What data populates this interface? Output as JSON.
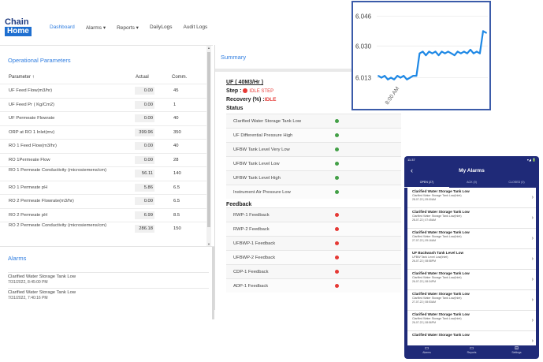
{
  "brand": {
    "line1": "Chain",
    "line2": "Home"
  },
  "nav": {
    "items": [
      "Dashboard",
      "Alarms ▾",
      "Reports ▾",
      "DailyLogs",
      "Audit Logs"
    ]
  },
  "operational": {
    "title": "Operational Parameters",
    "headers": {
      "param": "Parameter ↑",
      "actual": "Actual",
      "comm": "Comm."
    },
    "rows": [
      {
        "name": "UF Feed Flow(m3/hr)",
        "actual": "0.00",
        "comm": "45"
      },
      {
        "name": "UF Feed Pr ( Kg/Cm2)",
        "actual": "0.00",
        "comm": "1"
      },
      {
        "name": "UF Permeate Flowrate",
        "actual": "0.00",
        "comm": "40"
      },
      {
        "name": "ORP at RO 1 Inlet(mv)",
        "actual": "399.96",
        "comm": "350"
      },
      {
        "name": "RO 1 Feed Flow(m3/hr)",
        "actual": "0.00",
        "comm": "40"
      },
      {
        "name": "RO 1Permeate Flow",
        "actual": "0.00",
        "comm": "28"
      },
      {
        "name": "RO 1 Permeate Conductivity (microsiemens/cm)",
        "actual": "56.11",
        "comm": "140"
      },
      {
        "name": "RO 1 Permeate pH",
        "actual": "5.86",
        "comm": "6.5"
      },
      {
        "name": "RO 2 Permeate Flowrate(m3/hr)",
        "actual": "0.00",
        "comm": "6.5"
      },
      {
        "name": "RO 2 Permeate pH",
        "actual": "6.99",
        "comm": "8.5"
      },
      {
        "name": "RO 2 Permeate Conductivity (microsiemens/cm)",
        "actual": "286.18",
        "comm": "150"
      }
    ]
  },
  "alarms": {
    "title": "Alarms",
    "items": [
      {
        "text": "Clarified Water Storage Tank Low",
        "time": "7/31/2022, 8:45:00 PM"
      },
      {
        "text": "Clarified Water Storage Tank Low",
        "time": "7/31/2022, 7:40:16 PM"
      }
    ]
  },
  "summary": {
    "title": "Summary",
    "unit": "UF ( 40M3/Hr )",
    "step_label": "Step :",
    "step_value": "IDLE STEP",
    "recovery_label": "Recovery (%) :",
    "recovery_value": "IDLE",
    "status_title": "Status",
    "status": [
      {
        "label": "Clarified Water Storage Tank Low",
        "state": "green"
      },
      {
        "label": "UF Differential Pressure High",
        "state": "green"
      },
      {
        "label": "UFBW Tank Level Very Low",
        "state": "green"
      },
      {
        "label": "UFBW Tank Level Low",
        "state": "green"
      },
      {
        "label": "UFBW Tank Level High",
        "state": "green"
      },
      {
        "label": "Instrument Air Pressure Low",
        "state": "green"
      }
    ],
    "feedback_title": "Feedback",
    "feedback": [
      {
        "label": "RWP-1 Feedback",
        "state": "red"
      },
      {
        "label": "RWP-2 Feedback",
        "state": "red"
      },
      {
        "label": "UFBWP-1 Feedback",
        "state": "red"
      },
      {
        "label": "UFBWP-2 Feedback",
        "state": "red"
      },
      {
        "label": "CDP-1 Feedback",
        "state": "red"
      },
      {
        "label": "ADP-1 Feedback",
        "state": "red"
      }
    ]
  },
  "chart_data": {
    "type": "line",
    "title": "",
    "xlabel": "",
    "ylabel": "",
    "y_ticks": [
      "6.046",
      "6.030",
      "6.013"
    ],
    "x_ticks": [
      "8:00 AM"
    ],
    "ylim": [
      6.006,
      6.05
    ],
    "grid": true,
    "line_color": "#1e88e5",
    "series": [
      {
        "values": [
          6.014,
          6.013,
          6.014,
          6.012,
          6.013,
          6.012,
          6.014,
          6.013,
          6.014,
          6.012,
          6.013,
          6.014,
          6.014,
          6.026,
          6.027,
          6.025,
          6.027,
          6.026,
          6.027,
          6.025,
          6.027,
          6.026,
          6.027,
          6.026,
          6.025,
          6.027,
          6.026,
          6.027,
          6.026,
          6.028,
          6.026,
          6.027,
          6.026,
          6.038,
          6.037
        ]
      }
    ]
  },
  "mobile": {
    "status_time": "11:37",
    "status_right": "▾◢ 🔋",
    "title": "My Alarms",
    "back": "‹",
    "tabs": [
      "OPEN (27)",
      "ACK (0)",
      "CLOSED (0)"
    ],
    "items": [
      {
        "title": "Clarified Water Storage Tank Low",
        "sub": "Clarified Water Storage Tank Low(Inlet)",
        "time": "28-07-22 | 09:00AM"
      },
      {
        "title": "Clarified Water Storage Tank Low",
        "sub": "Clarified Water Storage Tank Low(Inlet)",
        "time": "28-07-22 | 07:45AM"
      },
      {
        "title": "Clarified Water Storage Tank Low",
        "sub": "Clarified Water Storage Tank Low(Inlet)",
        "time": "27-07-22 | 09:16AM"
      },
      {
        "title": "UF Backwash Tank Level Low",
        "sub": "UFBW Tank Level Low(Inlet)",
        "time": "26-07-22 | 08:58PM"
      },
      {
        "title": "Clarified Water Storage Tank Low",
        "sub": "Clarified Water Storage Tank Low(Inlet)",
        "time": "26-07-22 | 08:34PM"
      },
      {
        "title": "Clarified Water Storage Tank Low",
        "sub": "Clarified Water Storage Tank Low(Inlet)",
        "time": "27-07-22 | 08:53AM"
      },
      {
        "title": "Clarified Water Storage Tank Low",
        "sub": "Clarified Water Storage Tank Low(Inlet)",
        "time": "26-07-22 | 08:56PM"
      },
      {
        "title": "Clarified Water Storage Tank Low",
        "sub": "",
        "time": ""
      }
    ],
    "bottom": [
      "Alarms",
      "Reports",
      "Settings"
    ]
  }
}
